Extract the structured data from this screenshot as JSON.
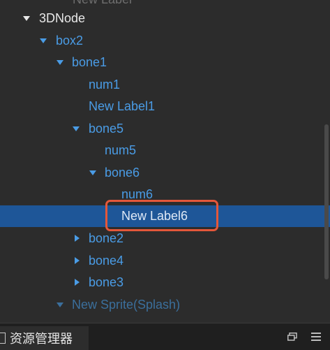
{
  "tree": {
    "partial_top_label": "New Label",
    "rows": [
      {
        "label": "3DNode",
        "arrow": "down-icon"
      },
      {
        "label": "box2",
        "arrow": "down-icon"
      },
      {
        "label": "bone1",
        "arrow": "down-icon"
      },
      {
        "label": "num1",
        "arrow": ""
      },
      {
        "label": "New Label1",
        "arrow": ""
      },
      {
        "label": "bone5",
        "arrow": "down-icon"
      },
      {
        "label": "num5",
        "arrow": ""
      },
      {
        "label": "bone6",
        "arrow": "down-icon"
      },
      {
        "label": "num6",
        "arrow": ""
      },
      {
        "label": "New Label6",
        "arrow": "",
        "selected": true
      },
      {
        "label": "bone2",
        "arrow": "right-icon"
      },
      {
        "label": "bone4",
        "arrow": "right-icon"
      },
      {
        "label": "bone3",
        "arrow": "right-icon"
      },
      {
        "label": "New Sprite(Splash)",
        "arrow": "down-icon"
      }
    ]
  },
  "bottom_panel": {
    "tab_label": "资源管理器",
    "icons": [
      "window-icon",
      "menu-icon"
    ]
  },
  "colors": {
    "background": "#2c2c2c",
    "node_text": "#4a9ce6",
    "root_text": "#e8e8e8",
    "selection": "#1e5698",
    "highlight_border": "#e4573a"
  }
}
